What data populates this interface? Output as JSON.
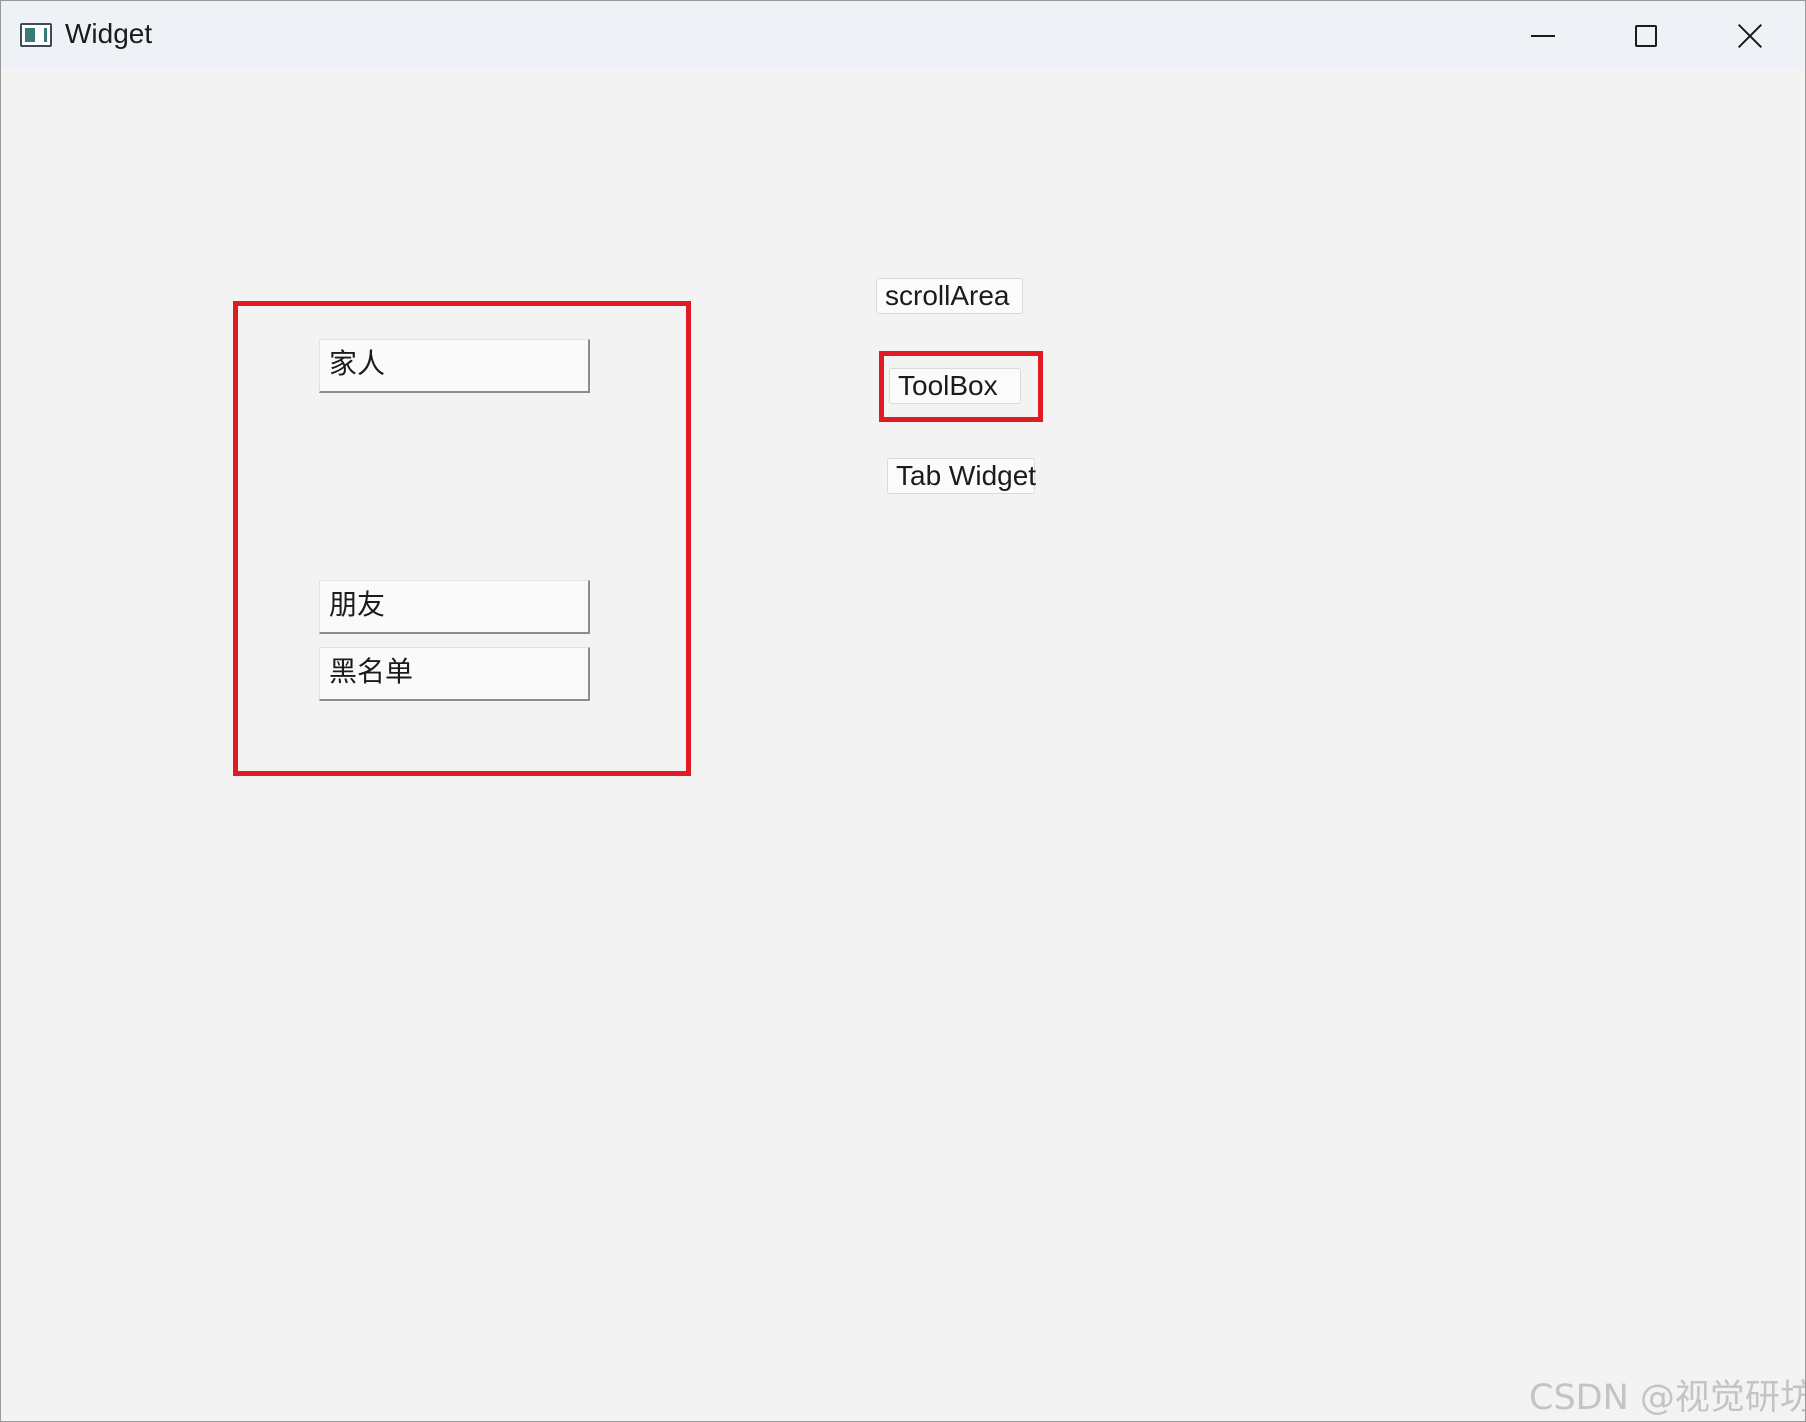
{
  "window": {
    "title": "Widget"
  },
  "titlebar": {
    "minimize_icon": "minimize-icon",
    "maximize_icon": "maximize-icon",
    "close_icon": "close-icon"
  },
  "toolbox_pages": [
    {
      "label": "家人"
    },
    {
      "label": "朋友"
    },
    {
      "label": "黑名单"
    }
  ],
  "nav_items": [
    {
      "label": "scrollArea"
    },
    {
      "label": "ToolBox"
    },
    {
      "label": "Tab Widget"
    }
  ],
  "annotations": {
    "highlight_color": "#e11b24"
  },
  "watermark": "CSDN @视觉研坊"
}
